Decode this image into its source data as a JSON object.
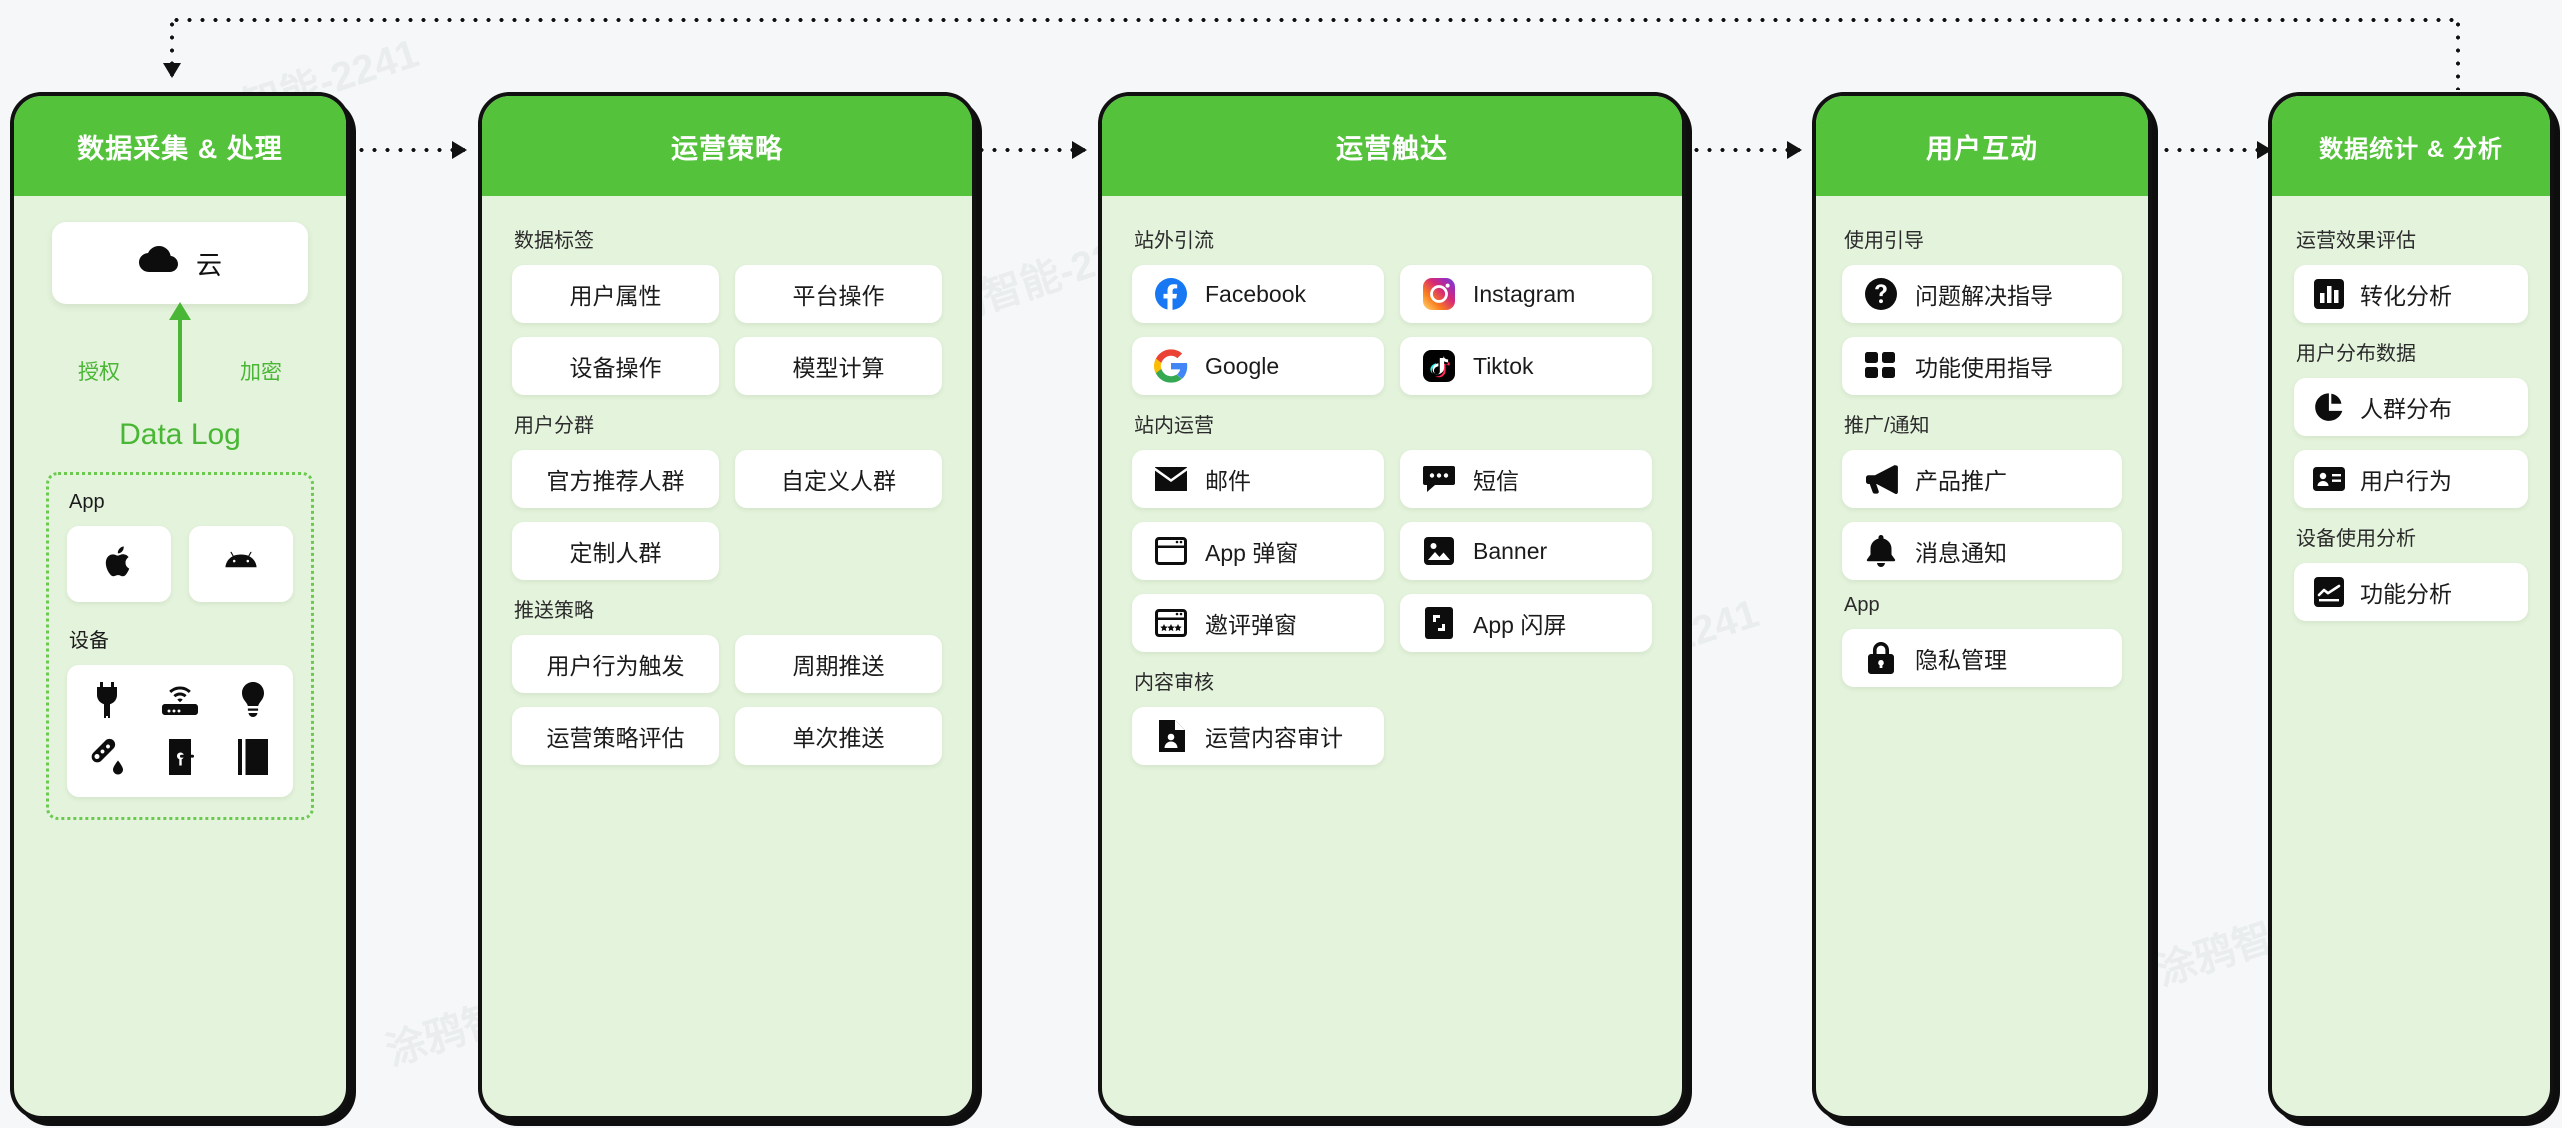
{
  "columns": [
    {
      "id": "data-collection",
      "title": "数据采集 & 处理",
      "cloud": {
        "label": "云",
        "icon": "cloud-icon"
      },
      "flow": {
        "left_label": "授权",
        "right_label": "加密",
        "data_log": "Data Log"
      },
      "app_section": {
        "label": "App",
        "platforms": [
          {
            "name": "apple",
            "icon": "apple-icon"
          },
          {
            "name": "android",
            "icon": "android-icon"
          }
        ]
      },
      "device_section": {
        "label": "设备",
        "devices": [
          {
            "name": "plug",
            "icon": "plug-icon"
          },
          {
            "name": "router",
            "icon": "router-icon"
          },
          {
            "name": "bulb",
            "icon": "bulb-icon"
          },
          {
            "name": "sensor",
            "icon": "temp-humidity-icon"
          },
          {
            "name": "lock",
            "icon": "door-lock-icon"
          },
          {
            "name": "curtain",
            "icon": "curtain-icon"
          }
        ]
      }
    },
    {
      "id": "operation-strategy",
      "title": "运营策略",
      "groups": [
        {
          "label": "数据标签",
          "cols": 2,
          "items": [
            {
              "text": "用户属性"
            },
            {
              "text": "平台操作"
            },
            {
              "text": "设备操作"
            },
            {
              "text": "模型计算"
            }
          ]
        },
        {
          "label": "用户分群",
          "cols": 2,
          "items": [
            {
              "text": "官方推荐人群"
            },
            {
              "text": "自定义人群"
            },
            {
              "text": "定制人群"
            }
          ]
        },
        {
          "label": "推送策略",
          "cols": 2,
          "items": [
            {
              "text": "用户行为触发"
            },
            {
              "text": "周期推送"
            },
            {
              "text": "运营策略评估"
            },
            {
              "text": "单次推送"
            }
          ]
        }
      ]
    },
    {
      "id": "operation-reach",
      "title": "运营触达",
      "groups": [
        {
          "label": "站外引流",
          "cols": 2,
          "items": [
            {
              "text": "Facebook",
              "icon": "facebook-icon"
            },
            {
              "text": "Instagram",
              "icon": "instagram-icon"
            },
            {
              "text": "Google",
              "icon": "google-icon"
            },
            {
              "text": "Tiktok",
              "icon": "tiktok-icon"
            }
          ]
        },
        {
          "label": "站内运营",
          "cols": 2,
          "items": [
            {
              "text": "邮件",
              "icon": "mail-icon"
            },
            {
              "text": "短信",
              "icon": "sms-icon"
            },
            {
              "text": "App 弹窗",
              "icon": "popup-icon"
            },
            {
              "text": "Banner",
              "icon": "image-icon"
            },
            {
              "text": "邀评弹窗",
              "icon": "review-popup-icon"
            },
            {
              "text": "App 闪屏",
              "icon": "splash-icon"
            }
          ]
        },
        {
          "label": "内容审核",
          "cols": 2,
          "items": [
            {
              "text": "运营内容审计",
              "icon": "audit-icon"
            }
          ]
        }
      ]
    },
    {
      "id": "user-interaction",
      "title": "用户互动",
      "groups": [
        {
          "label": "使用引导",
          "cols": 1,
          "items": [
            {
              "text": "问题解决指导",
              "icon": "question-icon"
            },
            {
              "text": "功能使用指导",
              "icon": "grid-icon"
            }
          ]
        },
        {
          "label": "推广/通知",
          "cols": 1,
          "items": [
            {
              "text": "产品推广",
              "icon": "megaphone-icon"
            },
            {
              "text": "消息通知",
              "icon": "bell-icon"
            }
          ]
        },
        {
          "label": "App",
          "cols": 1,
          "items": [
            {
              "text": "隐私管理",
              "icon": "lock-icon"
            }
          ]
        }
      ]
    },
    {
      "id": "data-analysis",
      "title": "数据统计 & 分析",
      "groups": [
        {
          "label": "运营效果评估",
          "cols": 1,
          "items": [
            {
              "text": "转化分析",
              "icon": "bar-chart-icon"
            }
          ]
        },
        {
          "label": "用户分布数据",
          "cols": 1,
          "items": [
            {
              "text": "人群分布",
              "icon": "pie-chart-icon"
            },
            {
              "text": "用户行为",
              "icon": "id-card-icon"
            }
          ]
        },
        {
          "label": "设备使用分析",
          "cols": 1,
          "items": [
            {
              "text": "功能分析",
              "icon": "line-chart-icon"
            }
          ]
        }
      ]
    }
  ],
  "colors": {
    "header_green": "#54c23b",
    "body_green": "#e4f3dc",
    "accent_green": "#49b735",
    "card_white": "#ffffff",
    "page_bg": "#f5f7f9"
  },
  "watermark": "涂鸦智能-2241"
}
